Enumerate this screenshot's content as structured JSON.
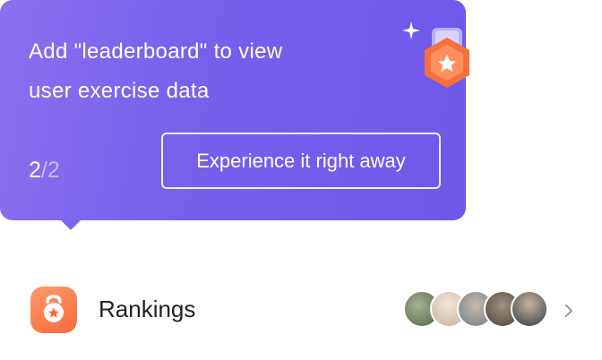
{
  "tooltip": {
    "message": "Add \"leaderboard\" to view\nuser exercise data",
    "step_current": "2",
    "step_separator": "/",
    "step_total": "2",
    "cta_label": "Experience it right away",
    "medal_icon": "medal-icon",
    "sparkle_icon": "sparkle-icon"
  },
  "row": {
    "icon": "kettlebell-icon",
    "label": "Rankings",
    "avatars": [
      {
        "name": "avatar-1",
        "color": "#5e6e4e"
      },
      {
        "name": "avatar-2",
        "color": "#d9c9b8"
      },
      {
        "name": "avatar-3",
        "color": "#8d9aa8"
      },
      {
        "name": "avatar-4",
        "color": "#6b6258"
      },
      {
        "name": "avatar-5",
        "color": "#3e4a55"
      }
    ],
    "chevron_icon": "chevron-right-icon"
  },
  "colors": {
    "tooltip_start": "#8a6ff0",
    "tooltip_end": "#6e58e8",
    "accent_orange": "#f56a3a"
  }
}
